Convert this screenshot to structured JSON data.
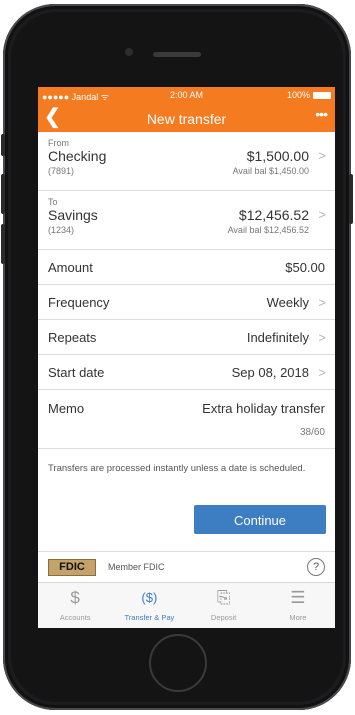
{
  "status_bar": {
    "carrier": "●●●●● Jandal ᯤ",
    "time": "2:00 AM",
    "battery": "100%"
  },
  "nav": {
    "back_icon": "chevron-left-icon",
    "title": "New transfer",
    "more_icon": "ellipsis-icon",
    "back_glyph": "❮",
    "more_glyph": "•••"
  },
  "from": {
    "label": "From",
    "name": "Checking",
    "number": "(7891)",
    "amount": "$1,500.00",
    "available": "Avail bal $1,450.00"
  },
  "to": {
    "label": "To",
    "name": "Savings",
    "number": "(1234)",
    "amount": "$12,456.52",
    "available": "Avail bal $12,456.52"
  },
  "amount": {
    "label": "Amount",
    "value": "$50.00"
  },
  "frequency": {
    "label": "Frequency",
    "value": "Weekly"
  },
  "repeats": {
    "label": "Repeats",
    "value": "Indefinitely"
  },
  "start_date": {
    "label": "Start date",
    "value": "Sep 08, 2018"
  },
  "memo": {
    "label": "Memo",
    "value": "Extra holiday transfer",
    "count": "38/60"
  },
  "note": "Transfers are processed instantly unless a date is scheduled.",
  "continue_label": "Continue",
  "fdic": {
    "logo_text": "FDIC",
    "member_text": "Member FDIC",
    "help_glyph": "?"
  },
  "tabs": [
    {
      "label": "Accounts",
      "icon": "dollar-icon",
      "glyph": "$"
    },
    {
      "label": "Transfer & Pay",
      "icon": "transfer-icon",
      "glyph": "($)"
    },
    {
      "label": "Deposit",
      "icon": "check-deposit-icon",
      "glyph": "⎘"
    },
    {
      "label": "More",
      "icon": "menu-icon",
      "glyph": "☰"
    }
  ],
  "colors": {
    "brand_orange": "#f47b20",
    "action_blue": "#3d7dc2"
  }
}
